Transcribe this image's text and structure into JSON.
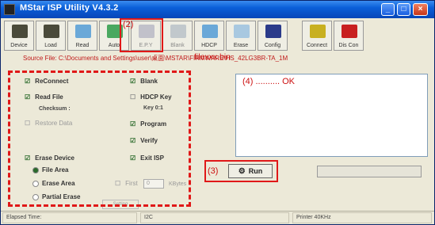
{
  "window": {
    "title": "MStar ISP Utility V4.3.2"
  },
  "toolbar": {
    "buttons": [
      {
        "label": "Device",
        "icon": "device-icon",
        "enabled": true,
        "color": "#4a4a3a"
      },
      {
        "label": "Load",
        "icon": "load-icon",
        "enabled": true,
        "color": "#4a4a3a"
      },
      {
        "label": "Read",
        "icon": "read-icon",
        "enabled": true,
        "color": "#6aa8d8"
      },
      {
        "label": "Auto",
        "icon": "auto-icon",
        "enabled": true,
        "color": "#4aa860"
      },
      {
        "label": "E.P.Y",
        "icon": "epy-icon",
        "enabled": false,
        "color": "#8a8aaa"
      },
      {
        "label": "Blank",
        "icon": "blank-icon",
        "enabled": false,
        "color": "#8a9ab0"
      },
      {
        "label": "HDCP",
        "icon": "hdcp-icon",
        "enabled": true,
        "color": "#6aa8d8"
      },
      {
        "label": "Erase",
        "icon": "erase-icon",
        "enabled": true,
        "color": "#a8c8e0"
      },
      {
        "label": "Config",
        "icon": "config-icon",
        "enabled": true,
        "color": "#2a3a8a"
      },
      {
        "label": "Connect",
        "icon": "connect-icon",
        "enabled": true,
        "color": "#c8b020"
      },
      {
        "label": "Dis Con",
        "icon": "disconnect-icon",
        "enabled": true,
        "color": "#c82020"
      }
    ]
  },
  "source_file": {
    "text": "Source File: C:\\Documents and Settings\\user\\桌面\\MSTAR\\FIRMWARE\\HS_42LG3BR-TA_1M",
    "filename": "filexxx.bin"
  },
  "options": {
    "reconnect": "ReConnect",
    "read_file": "Read File",
    "checksum": "Checksum :",
    "restore_data": "Restore Data",
    "erase_device": "Erase Device",
    "file_area": "File Area",
    "erase_area": "Erase Area",
    "partial_erase": "Partial Erase",
    "blank": "Blank",
    "hdcp_key": "HDCP Key",
    "key_value": "Key 0:1",
    "program": "Program",
    "verify": "Verify",
    "exit_isp": "Exit ISP",
    "first_label": "First",
    "first_value": "0",
    "kbytes": "KBytes",
    "bottom_button": "Setting"
  },
  "log": {
    "text": "(4) .......... OK"
  },
  "run": {
    "label": "Run"
  },
  "annotations": {
    "step2": "(2)",
    "step3": "(3)"
  },
  "statusbar": {
    "elapsed": "Elapsed Time:",
    "interface": "I2C",
    "printer": "Printer  40KHz"
  },
  "colors": {
    "accent": "#e01818",
    "titlebar": "#0a5fd8"
  }
}
